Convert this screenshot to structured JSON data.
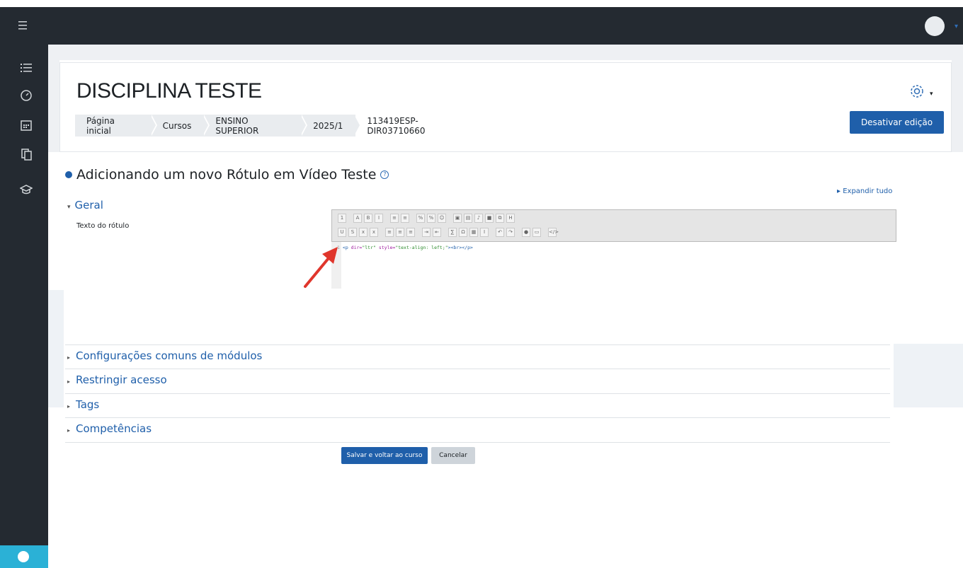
{
  "colors": {
    "topbar": "#242a31",
    "primary": "#1f5faa",
    "accessibility": "#2bb1d6"
  },
  "topbar": {
    "menu_icon": "hamburger-icon",
    "user_menu_icon": "avatar"
  },
  "sidebar": {
    "items": [
      {
        "icon": "list-icon"
      },
      {
        "icon": "dashboard-icon"
      },
      {
        "icon": "calendar-icon"
      },
      {
        "icon": "files-icon"
      },
      {
        "icon": "graduation-cap-icon"
      }
    ],
    "bottom_icon": "accessibility-icon"
  },
  "header": {
    "course_title": "DISCIPLINA TESTE",
    "breadcrumb": [
      "Página inicial",
      "Cursos",
      "ENSINO SUPERIOR",
      "2025/1",
      "113419ESP-DIR03710660"
    ],
    "edit_button": "Desativar edição"
  },
  "form": {
    "heading": "Adicionando um novo Rótulo em Vídeo Teste",
    "help_icon": "help-icon",
    "expand_all": "Expandir tudo",
    "general_section": "Geral",
    "field_label": "Texto do rótulo",
    "editor": {
      "line_number": "1",
      "code_tag_open": "<p",
      "code_attr1": " dir=",
      "code_val1": "\"ltr\"",
      "code_attr2": " style=",
      "code_val2": "\"text-align: left;\"",
      "code_tail": "><br></p>"
    },
    "collapsed_sections": [
      "Configurações comuns de módulos",
      "Restringir acesso",
      "Tags",
      "Competências"
    ],
    "save_button": "Salvar e voltar ao curso",
    "cancel_button": "Cancelar"
  }
}
